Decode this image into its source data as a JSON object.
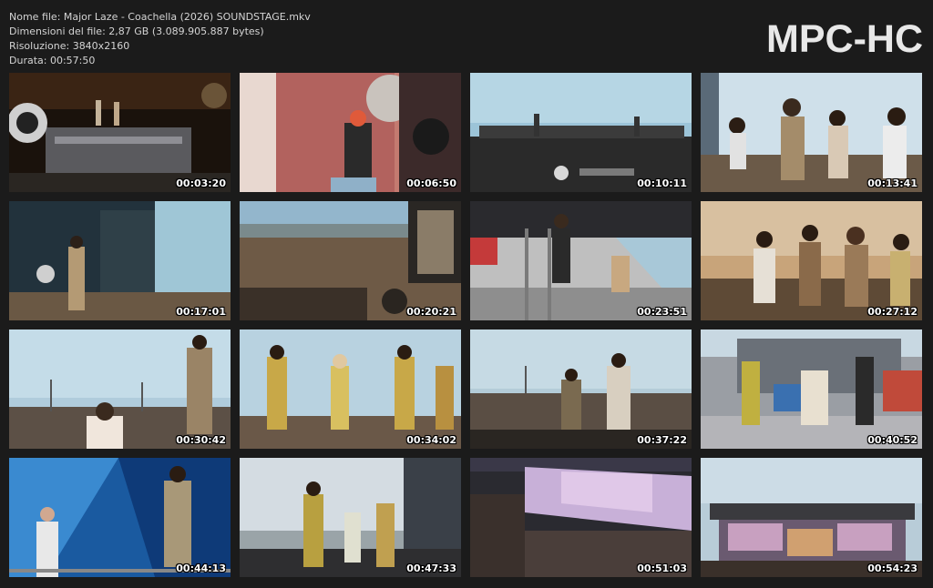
{
  "file_info": {
    "name": "Nome file: Major Laze - Coachella (2026) SOUNDSTAGE.mkv",
    "size": "Dimensioni del file: 2,87 GB (3.089.905.887 bytes)",
    "resolution": "Risoluzione: 3840x2160",
    "duration": "Durata: 00:57:50"
  },
  "logo": "MPC-HC",
  "thumbnails": [
    {
      "time": "00:03:20",
      "scene": "stage-night"
    },
    {
      "time": "00:06:50",
      "scene": "performer-screen"
    },
    {
      "time": "00:10:11",
      "scene": "stage-wide-sky"
    },
    {
      "time": "00:13:41",
      "scene": "dancers-sky"
    },
    {
      "time": "00:17:01",
      "scene": "stage-crowd"
    },
    {
      "time": "00:20:21",
      "scene": "aerial-crowd"
    },
    {
      "time": "00:23:51",
      "scene": "ladder-climb"
    },
    {
      "time": "00:27:12",
      "scene": "dancers-sunset"
    },
    {
      "time": "00:30:42",
      "scene": "singer-crowd"
    },
    {
      "time": "00:34:02",
      "scene": "dancers-line"
    },
    {
      "time": "00:37:22",
      "scene": "stage-crowd-2"
    },
    {
      "time": "00:40:52",
      "scene": "dancers-smoke"
    },
    {
      "time": "00:44:13",
      "scene": "blue-lights"
    },
    {
      "time": "00:47:33",
      "scene": "dancers-stage"
    },
    {
      "time": "00:51:03",
      "scene": "night-screen"
    },
    {
      "time": "00:54:23",
      "scene": "stage-dusk"
    }
  ]
}
